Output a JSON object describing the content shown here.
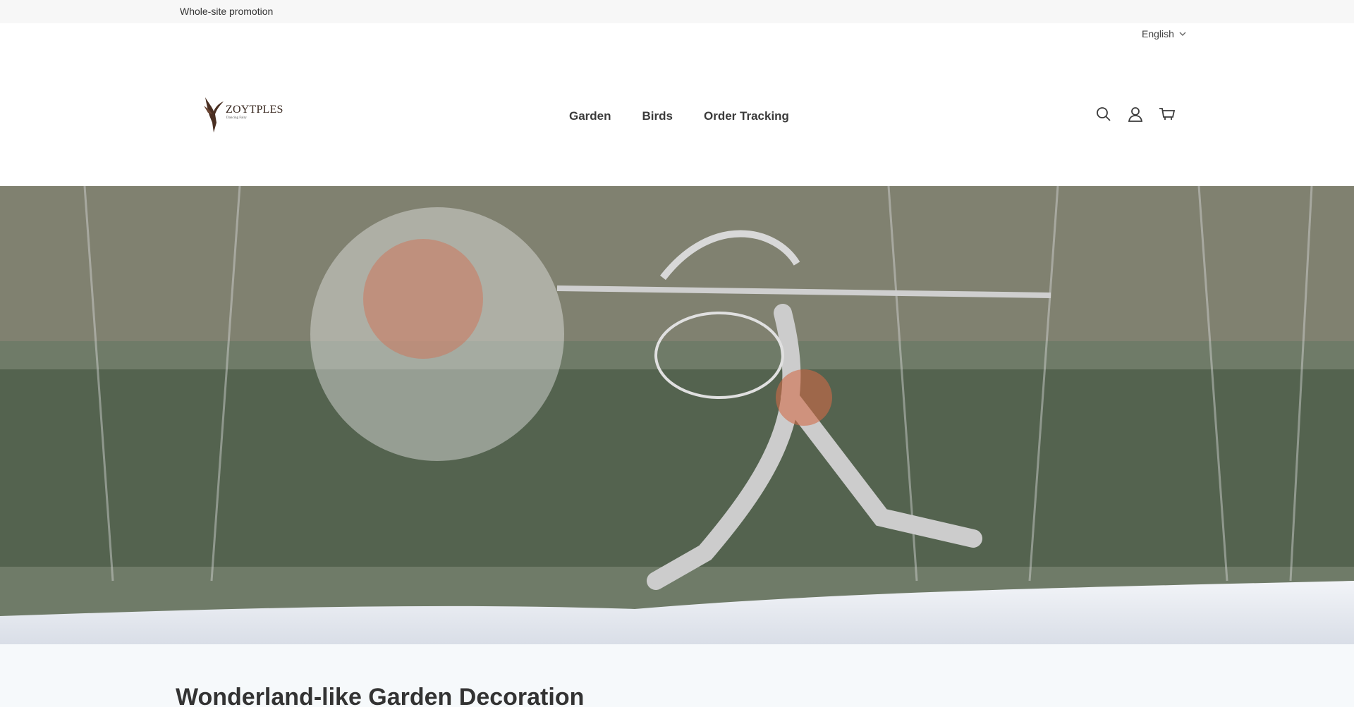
{
  "announcement": {
    "text": "Whole-site promotion"
  },
  "language": {
    "label": "English"
  },
  "logo": {
    "brand": "ZOYTPLES",
    "tagline": "Dancing Fairy"
  },
  "nav": {
    "items": [
      {
        "label": "Garden"
      },
      {
        "label": "Birds"
      },
      {
        "label": "Order Tracking"
      }
    ]
  },
  "header_icons": [
    "search-icon",
    "account-icon",
    "cart-icon"
  ],
  "hero": {
    "alt": "wire sculpture of fairy holding dandelion in snowy forest"
  },
  "section": {
    "title": "Wonderland-like Garden Decoration"
  },
  "colors": {
    "announcement_bg": "#f7f7f7",
    "text": "#333333",
    "strip_bg": "#f6f9fb"
  }
}
